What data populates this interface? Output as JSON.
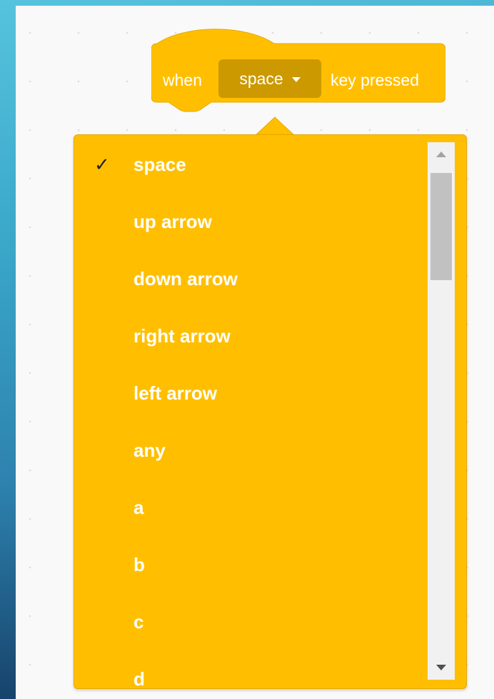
{
  "block": {
    "prefix": "when",
    "selected_key": "space",
    "suffix": "key pressed",
    "color": "#ffbf00",
    "dropdown_color": "#cc9900"
  },
  "dropdown": {
    "selected_index": 0,
    "items": [
      {
        "label": "space"
      },
      {
        "label": "up arrow"
      },
      {
        "label": "down arrow"
      },
      {
        "label": "right arrow"
      },
      {
        "label": "left arrow"
      },
      {
        "label": "any"
      },
      {
        "label": "a"
      },
      {
        "label": "b"
      },
      {
        "label": "c"
      },
      {
        "label": "d"
      }
    ],
    "check_mark": "✓",
    "scroll_fraction": 0.0
  }
}
